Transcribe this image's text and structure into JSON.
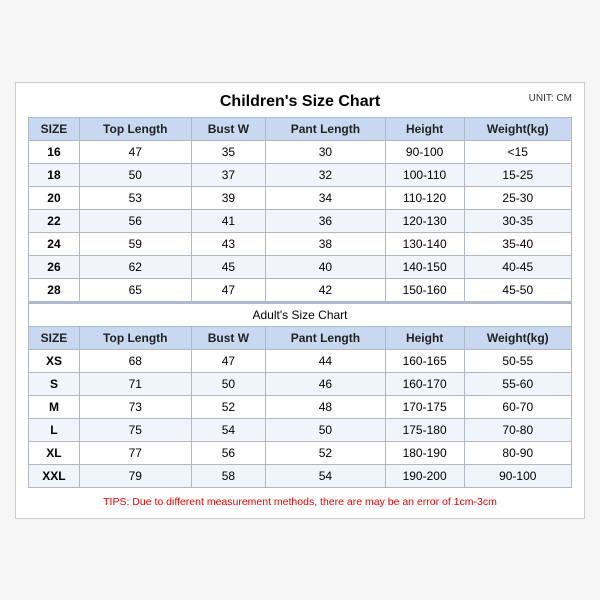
{
  "title": "Children's Size Chart",
  "unit": "UNIT: CM",
  "children": {
    "section_title": "Children's Size Chart",
    "headers": [
      "SIZE",
      "Top Length",
      "Bust W",
      "Pant Length",
      "Height",
      "Weight(kg)"
    ],
    "rows": [
      [
        "16",
        "47",
        "35",
        "30",
        "90-100",
        "<15"
      ],
      [
        "18",
        "50",
        "37",
        "32",
        "100-110",
        "15-25"
      ],
      [
        "20",
        "53",
        "39",
        "34",
        "110-120",
        "25-30"
      ],
      [
        "22",
        "56",
        "41",
        "36",
        "120-130",
        "30-35"
      ],
      [
        "24",
        "59",
        "43",
        "38",
        "130-140",
        "35-40"
      ],
      [
        "26",
        "62",
        "45",
        "40",
        "140-150",
        "40-45"
      ],
      [
        "28",
        "65",
        "47",
        "42",
        "150-160",
        "45-50"
      ]
    ]
  },
  "adults": {
    "section_title": "Adult's Size Chart",
    "headers": [
      "SIZE",
      "Top Length",
      "Bust W",
      "Pant Length",
      "Height",
      "Weight(kg)"
    ],
    "rows": [
      [
        "XS",
        "68",
        "47",
        "44",
        "160-165",
        "50-55"
      ],
      [
        "S",
        "71",
        "50",
        "46",
        "160-170",
        "55-60"
      ],
      [
        "M",
        "73",
        "52",
        "48",
        "170-175",
        "60-70"
      ],
      [
        "L",
        "75",
        "54",
        "50",
        "175-180",
        "70-80"
      ],
      [
        "XL",
        "77",
        "56",
        "52",
        "180-190",
        "80-90"
      ],
      [
        "XXL",
        "79",
        "58",
        "54",
        "190-200",
        "90-100"
      ]
    ]
  },
  "tips": "TIPS: Due to different measurement methods, there are may be an error of 1cm-3cm"
}
